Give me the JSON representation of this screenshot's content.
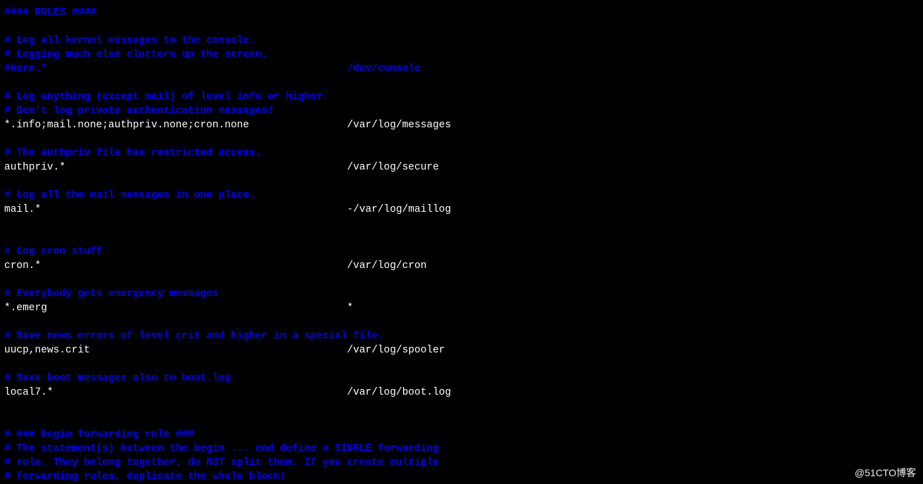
{
  "lines": [
    {
      "type": "comment",
      "text": "#### RULES ####"
    },
    {
      "type": "blank",
      "text": ""
    },
    {
      "type": "comment",
      "text": "# Log all kernel messages to the console."
    },
    {
      "type": "comment",
      "text": "# Logging much else clutters up the screen."
    },
    {
      "type": "comment",
      "text": "#kern.*                                                 /dev/console"
    },
    {
      "type": "blank",
      "text": ""
    },
    {
      "type": "comment",
      "text": "# Log anything (except mail) of level info or higher."
    },
    {
      "type": "comment",
      "text": "# Don't log private authentication messages!"
    },
    {
      "type": "rule",
      "text": "*.info;mail.none;authpriv.none;cron.none                /var/log/messages"
    },
    {
      "type": "blank",
      "text": ""
    },
    {
      "type": "comment",
      "text": "# The authpriv file has restricted access."
    },
    {
      "type": "rule",
      "text": "authpriv.*                                              /var/log/secure"
    },
    {
      "type": "blank",
      "text": ""
    },
    {
      "type": "comment",
      "text": "# Log all the mail messages in one place."
    },
    {
      "type": "rule",
      "text": "mail.*                                                  -/var/log/maillog"
    },
    {
      "type": "blank",
      "text": ""
    },
    {
      "type": "blank",
      "text": ""
    },
    {
      "type": "comment",
      "text": "# Log cron stuff"
    },
    {
      "type": "rule",
      "text": "cron.*                                                  /var/log/cron"
    },
    {
      "type": "blank",
      "text": ""
    },
    {
      "type": "comment",
      "text": "# Everybody gets emergency messages"
    },
    {
      "type": "rule",
      "text": "*.emerg                                                 *"
    },
    {
      "type": "blank",
      "text": ""
    },
    {
      "type": "comment",
      "text": "# Save news errors of level crit and higher in a special file."
    },
    {
      "type": "rule",
      "text": "uucp,news.crit                                          /var/log/spooler"
    },
    {
      "type": "blank",
      "text": ""
    },
    {
      "type": "comment",
      "text": "# Save boot messages also to boot.log"
    },
    {
      "type": "rule",
      "text": "local7.*                                                /var/log/boot.log"
    },
    {
      "type": "blank",
      "text": ""
    },
    {
      "type": "blank",
      "text": ""
    },
    {
      "type": "comment",
      "text": "# ### begin forwarding rule ###"
    },
    {
      "type": "comment",
      "text": "# The statement(s) between the begin ... end define a SINGLE forwarding"
    },
    {
      "type": "comment",
      "text": "# rule. They belong together, do NOT split them. If you create multiple"
    },
    {
      "type": "comment",
      "text": "# forwarding rules, duplicate the whole block!"
    }
  ],
  "watermark": "@51CTO博客"
}
